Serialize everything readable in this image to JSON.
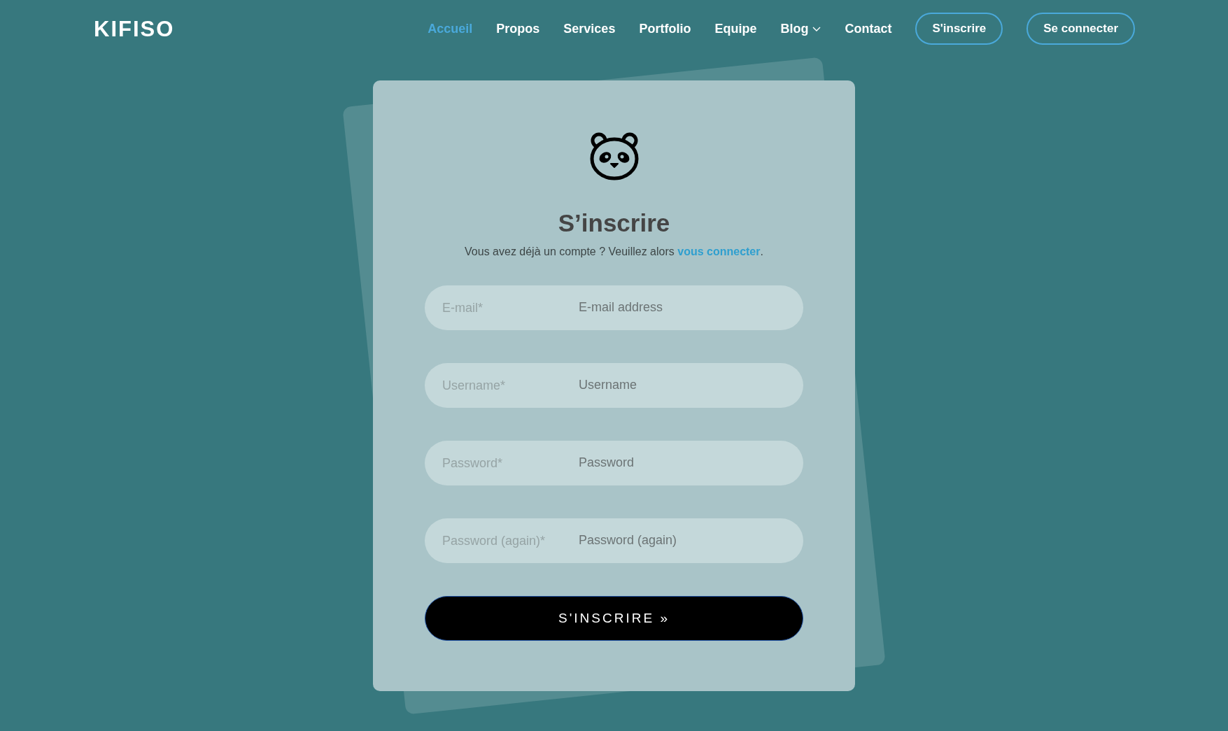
{
  "nav": {
    "logo": "KIFISO",
    "links": [
      {
        "label": "Accueil",
        "selected": true,
        "has_menu": false
      },
      {
        "label": "Propos",
        "selected": false,
        "has_menu": false
      },
      {
        "label": "Services",
        "selected": false,
        "has_menu": false
      },
      {
        "label": "Portfolio",
        "selected": false,
        "has_menu": false
      },
      {
        "label": "Equipe",
        "selected": false,
        "has_menu": false
      },
      {
        "label": "Blog",
        "selected": false,
        "has_menu": true
      },
      {
        "label": "Contact",
        "selected": false,
        "has_menu": false
      }
    ],
    "buttons": [
      "S'inscrire",
      "Se connecter"
    ]
  },
  "form": {
    "title": "S’inscrire",
    "prompt": "Vous avez déjà un compte ? Veuillez alors ",
    "prompt_link": "vous connecter",
    "prompt_end": ".",
    "fields": [
      {
        "label": "E-mail*",
        "placeholder": "E-mail address"
      },
      {
        "label": "Username*",
        "placeholder": "Username"
      },
      {
        "label": "Password*",
        "placeholder": "Password"
      },
      {
        "label": "Password (again)*",
        "placeholder": "Password (again)"
      }
    ],
    "submit": "S'INSCRIRE »"
  }
}
